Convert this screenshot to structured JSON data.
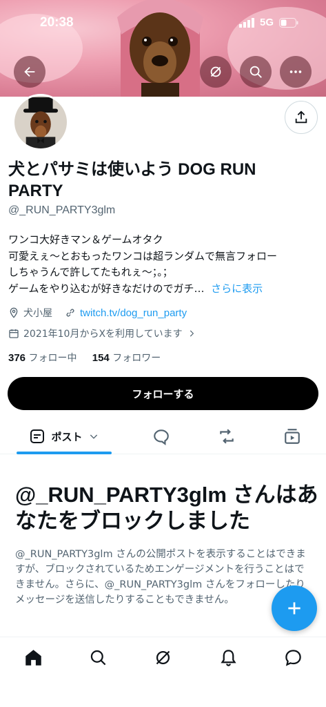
{
  "status_bar": {
    "time": "20:38",
    "network": "5G"
  },
  "banner": {
    "back_icon": "arrow-left-icon",
    "grok_icon": "grok-slash-icon",
    "search_icon": "search-icon",
    "more_icon": "more-dots-icon"
  },
  "profile": {
    "name": "犬とパサミは使いよう DOG RUN PARTY",
    "handle": "@_RUN_PARTY3glm",
    "bio_lines": [
      "ワンコ大好きマン＆ゲームオタク",
      "可愛えぇ〜とおもったワンコは超ランダムで無言フォロー",
      "しちゃうんで許してたもれぇ〜；。；",
      "ゲームをやり込むが好きなだけのでガチ…"
    ],
    "bio_more": "さらに表示",
    "location": "犬小屋",
    "website": "twitch.tv/dog_run_party",
    "joined": "2021年10月からXを利用しています",
    "following_count": "376",
    "following_label": "フォロー中",
    "followers_count": "154",
    "followers_label": "フォロワー",
    "follow_button": "フォローする"
  },
  "tabs": {
    "posts_label": "ポスト"
  },
  "blocked": {
    "title": "@_RUN_PARTY3glm さんはあなたをブロックしました",
    "message": "@_RUN_PARTY3glm さんの公開ポストを表示することはできますが、ブロックされているためエンゲージメントを行うことはできません。さらに、@_RUN_PARTY3glm さんをフォローしたりメッセージを送信したりすることもできません。"
  },
  "colors": {
    "accent": "#1d9bf0",
    "text": "#0f1419",
    "secondary": "#536471"
  }
}
